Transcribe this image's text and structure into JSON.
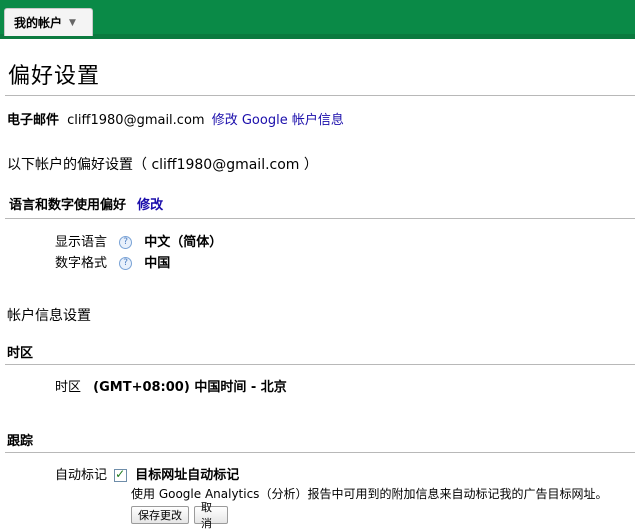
{
  "tab": {
    "label": "我的帐户",
    "arrow": "▼"
  },
  "page_title": "偏好设置",
  "email_row": {
    "label": "电子邮件",
    "value": "cliff1980@gmail.com",
    "link": "修改 Google 帐户信息"
  },
  "prefs_for": "以下帐户的偏好设置（ cliff1980@gmail.com ）",
  "lang_section": {
    "title": "语言和数字使用偏好",
    "edit_link": "修改",
    "display_lang_label": "显示语言",
    "display_lang_value": "中文（简体）",
    "number_format_label": "数字格式",
    "number_format_value": "中国",
    "help": "?"
  },
  "account_settings_title": "帐户信息设置",
  "timezone": {
    "section": "时区",
    "label": "时区",
    "value": "(GMT+08:00) 中国时间 - 北京"
  },
  "tracking": {
    "section": "跟踪",
    "label": "自动标记",
    "checkbox_label": "目标网址自动标记",
    "checked": true,
    "description": "使用 Google Analytics（分析）报告中可用到的附加信息来自动标记我的广告目标网址。"
  },
  "buttons": {
    "save": "保存更改",
    "cancel": "取消"
  },
  "colors": {
    "topbar": "#0a8a47",
    "link": "#1a0dab"
  }
}
